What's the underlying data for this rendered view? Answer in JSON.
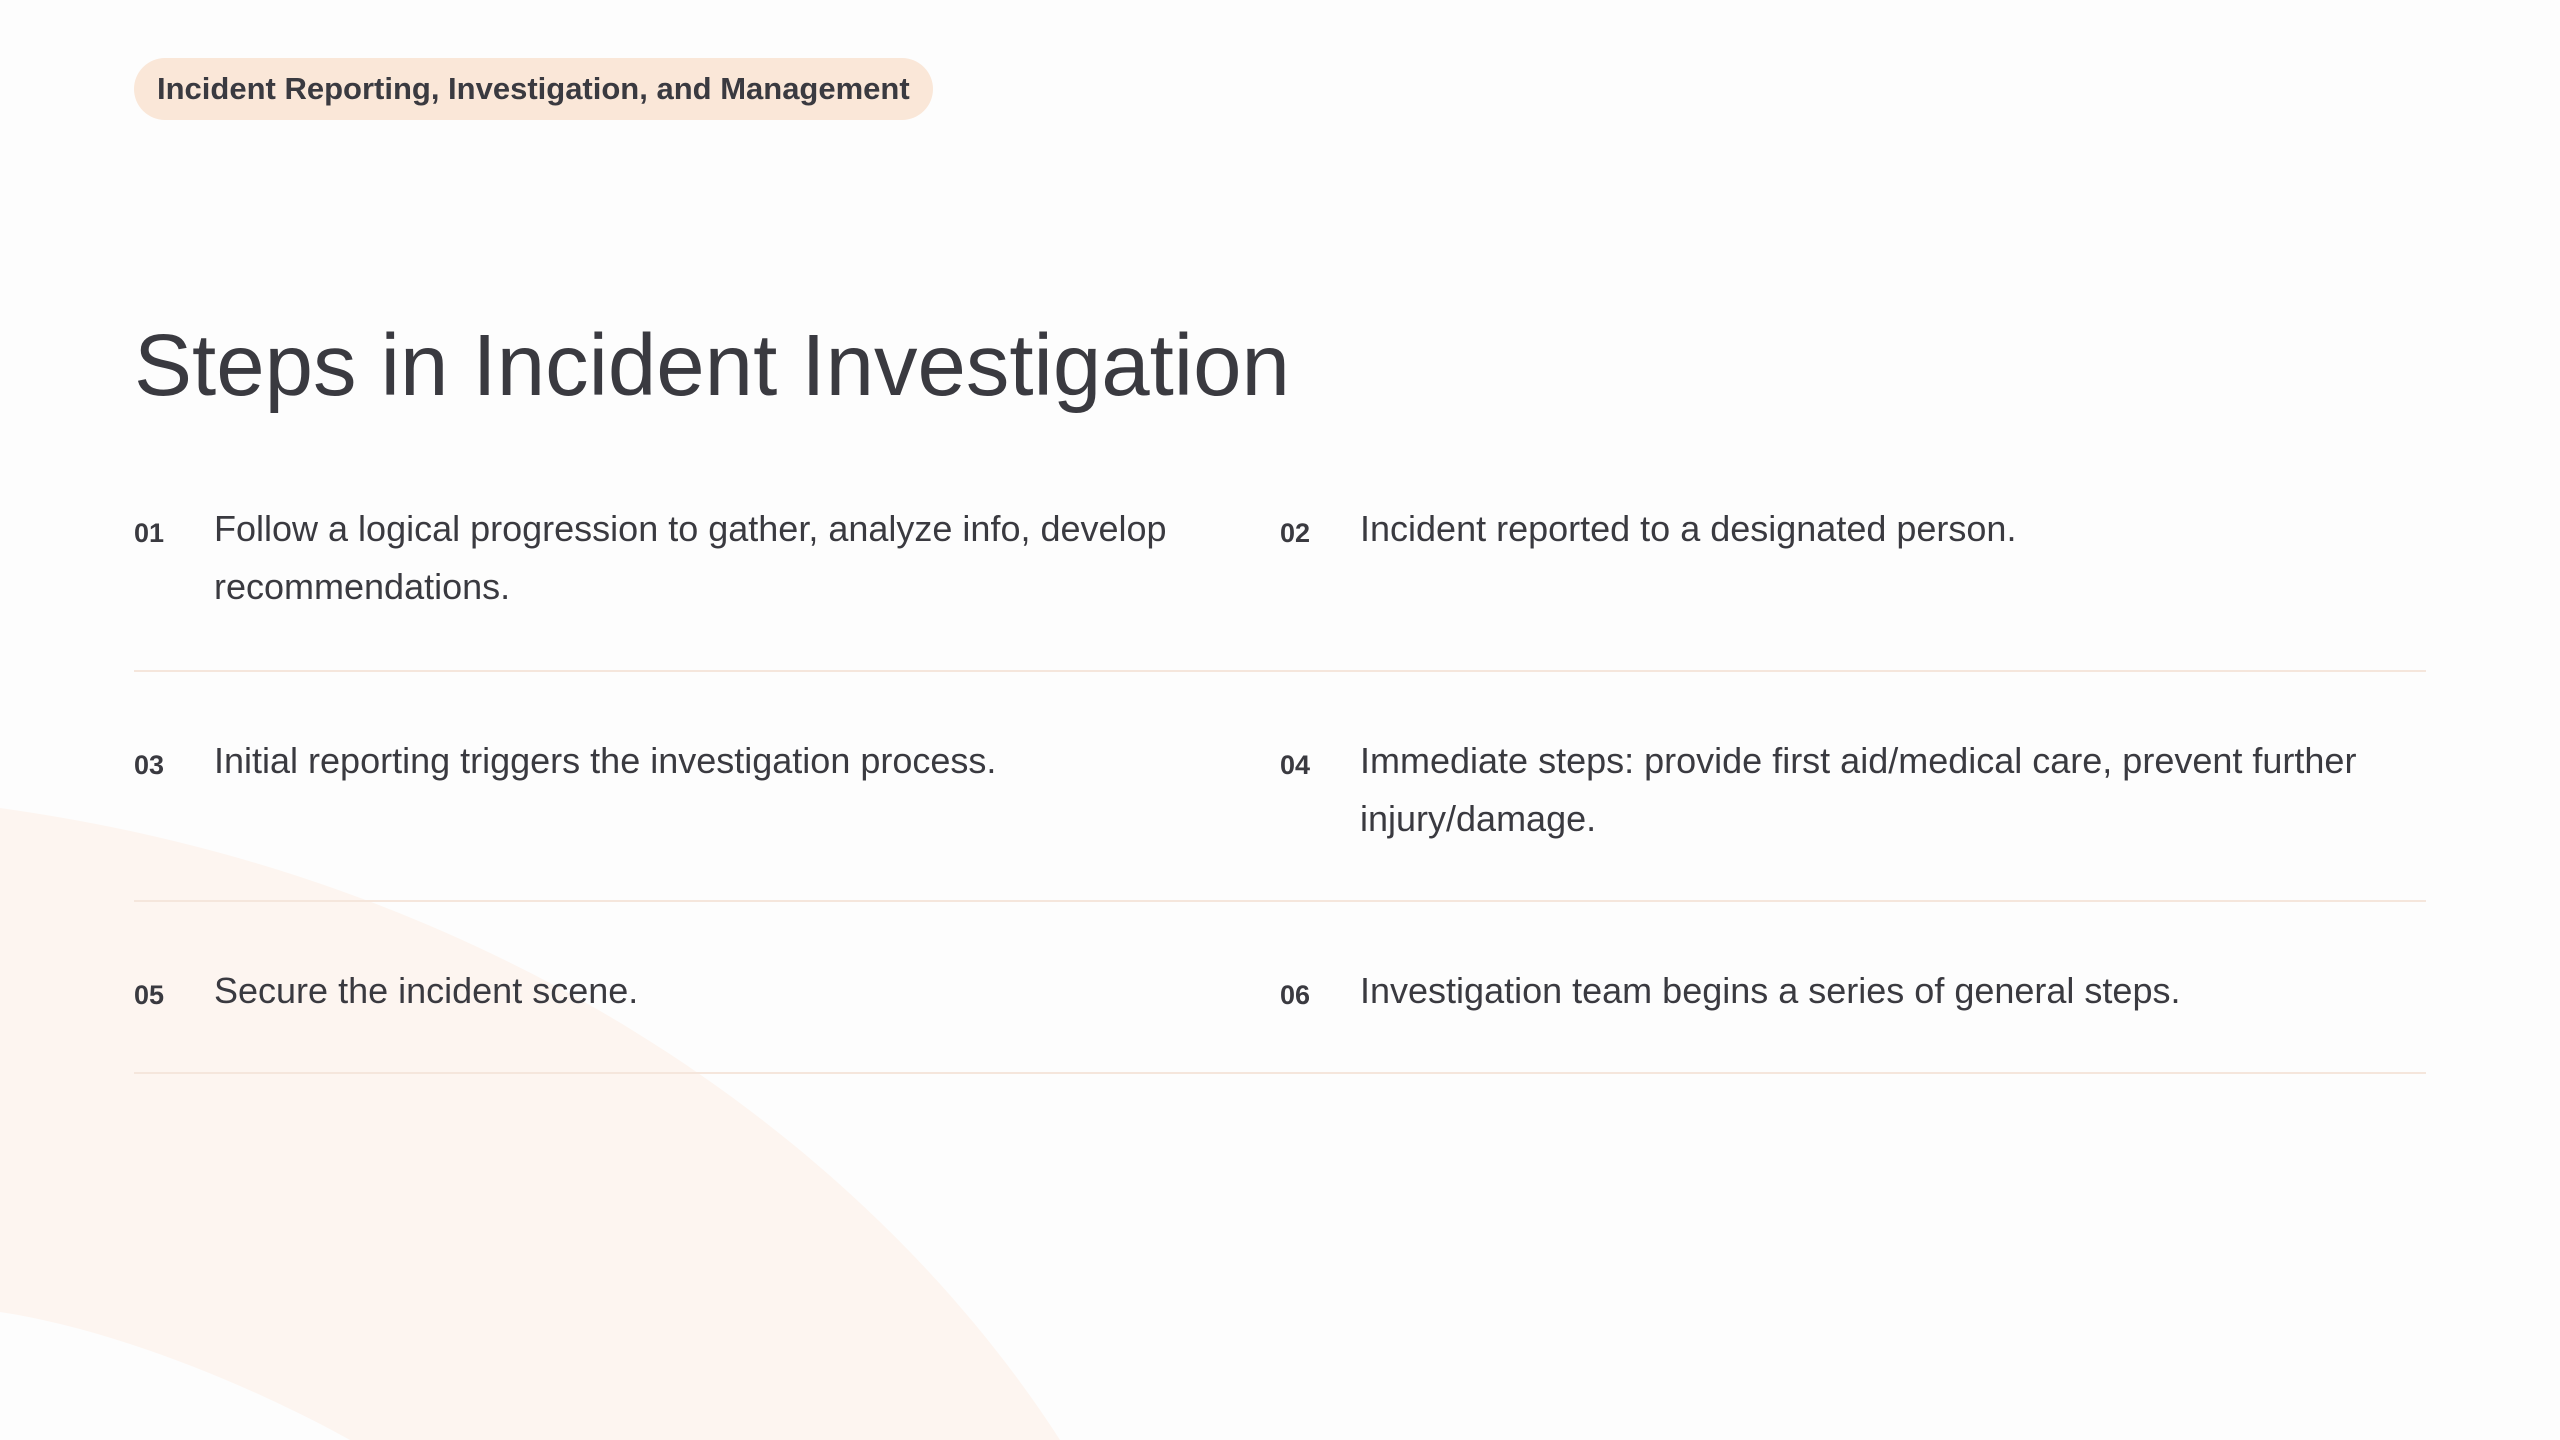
{
  "header": {
    "label": "Incident Reporting, Investigation, and Management"
  },
  "page": {
    "title": "Steps in Incident Investigation"
  },
  "colors": {
    "background": "#fdfdfd",
    "pill": "#fae7d8",
    "text": "#3a3a40",
    "divider": "#f5e6dc",
    "decorative_arc": "#fdf5f0"
  },
  "steps": [
    {
      "number": "01",
      "text": "Follow a logical progression to gather, analyze info, develop recommendations."
    },
    {
      "number": "02",
      "text": "Incident reported to a designated person."
    },
    {
      "number": "03",
      "text": "Initial reporting triggers the investigation process."
    },
    {
      "number": "04",
      "text": "Immediate steps: provide first aid/medical care, prevent further injury/damage."
    },
    {
      "number": "05",
      "text": "Secure the incident scene."
    },
    {
      "number": "06",
      "text": "Investigation team begins a series of general steps."
    }
  ]
}
